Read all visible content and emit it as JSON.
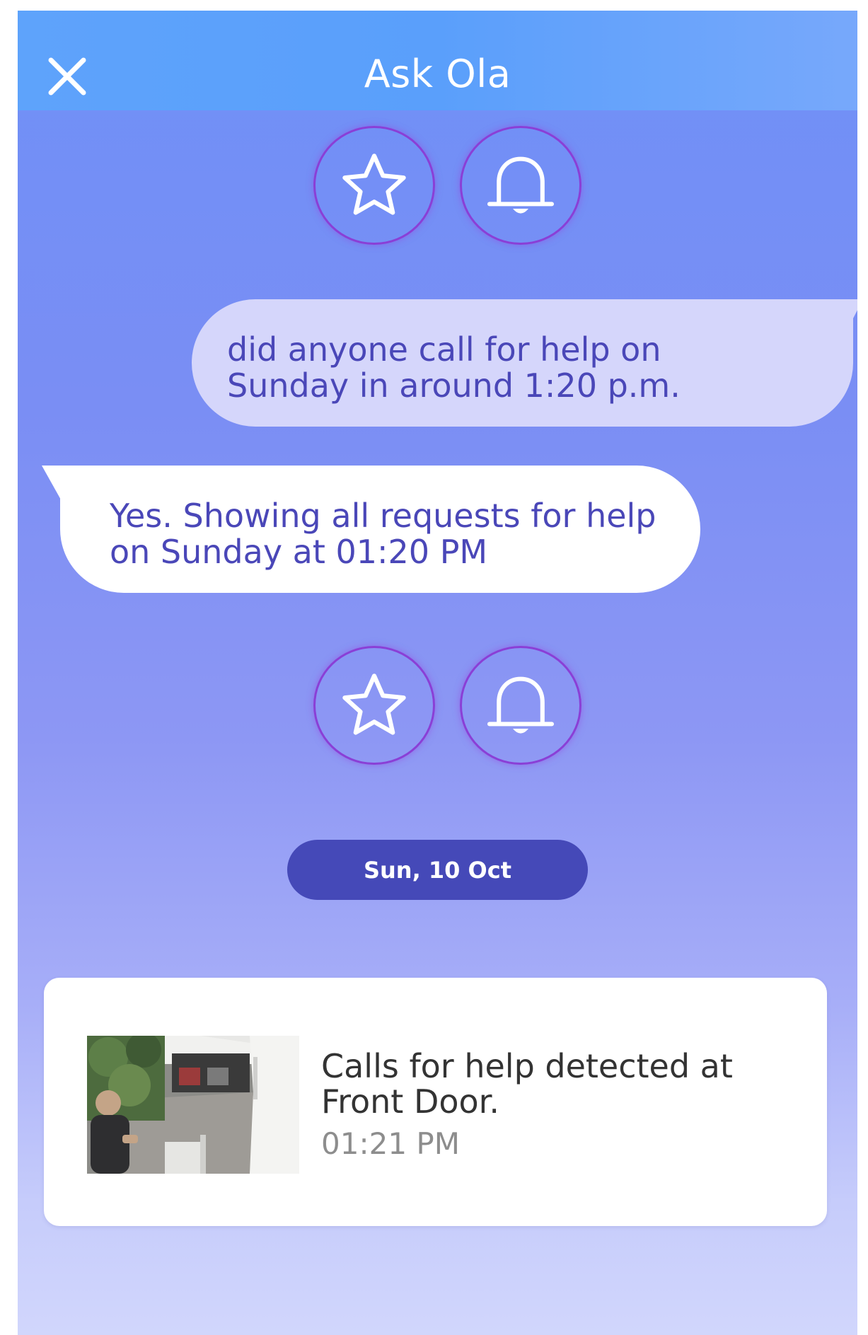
{
  "header": {
    "title": "Ask Ola",
    "close_icon": "close-icon"
  },
  "colors": {
    "header": "#5ea3fb",
    "date_pill": "#4549b8",
    "icon_ring": "#8a3fd6",
    "text_accent": "#4a47b8"
  },
  "quick_actions": [
    {
      "icon": "star-icon"
    },
    {
      "icon": "bell-icon"
    }
  ],
  "conversation": {
    "user_message": {
      "line1": "did anyone call for help on",
      "line2": "Sunday in around 1:20 p.m."
    },
    "bot_message": {
      "line1": "Yes. Showing all requests for help",
      "line2": "on Sunday at 01:20 PM"
    }
  },
  "date_separator": "Sun, 10 Oct",
  "event": {
    "line1": "Calls for help detected at",
    "line2": "Front Door.",
    "time": "01:21 PM",
    "thumbnail_icon": "camera-snapshot"
  }
}
